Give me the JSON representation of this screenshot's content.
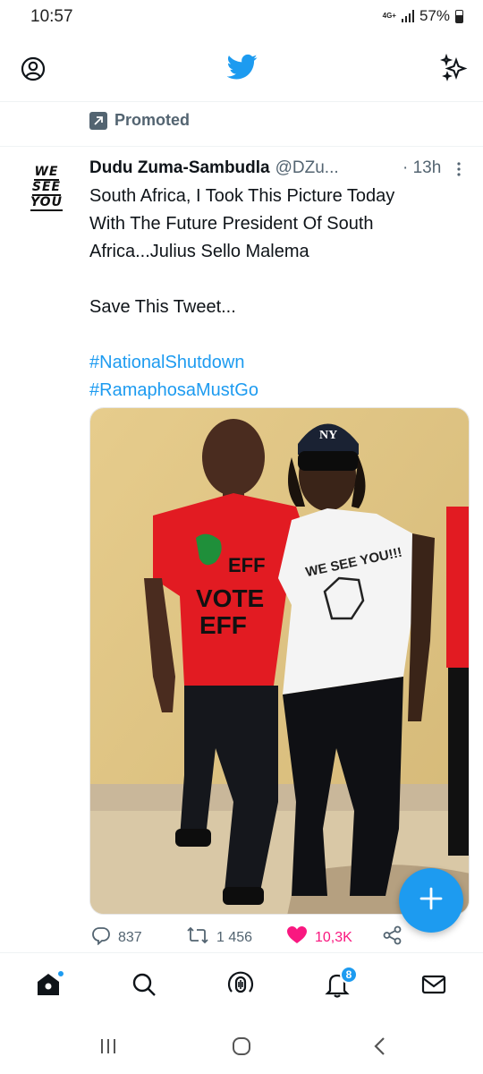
{
  "status_bar": {
    "time": "10:57",
    "network": "4G+",
    "battery": "57%"
  },
  "promoted": {
    "label": "Promoted"
  },
  "tweet": {
    "display_name": "Dudu Zuma-Sambudla",
    "handle": "@DZu...",
    "time": "· 13h",
    "avatar_text": [
      "WE",
      "SEE",
      "YOU"
    ],
    "lines": [
      "South Africa, I Took This Picture Today",
      "With The Future President Of South",
      "Africa...Julius Sello Malema",
      "",
      "Save This Tweet...",
      ""
    ],
    "hashtags": [
      "#NationalShutdown",
      "#RamaphosaMustGo"
    ],
    "photo_text": {
      "shirt_left": [
        "VOTE",
        "EFF"
      ],
      "shirt_logo": "EFF",
      "shirt_right": "WE SEE YOU!!!",
      "cap": "NY"
    },
    "stats": {
      "replies": "837",
      "retweets": "1 456",
      "likes": "10,3K"
    }
  },
  "bottom_nav": {
    "notifications_badge": "8"
  },
  "colors": {
    "accent": "#1d9bf0",
    "like": "#f91880",
    "secondary": "#536471"
  },
  "icons": [
    "profile-icon",
    "twitter-bird-icon",
    "sparkle-icon",
    "promoted-arrow-icon",
    "more-dots-icon",
    "reply-icon",
    "retweet-icon",
    "heart-icon",
    "share-icon",
    "compose-plus-icon",
    "home-icon",
    "search-icon",
    "spaces-icon",
    "bell-icon",
    "mail-icon",
    "recents-icon",
    "home-circle-icon",
    "back-chevron-icon"
  ]
}
